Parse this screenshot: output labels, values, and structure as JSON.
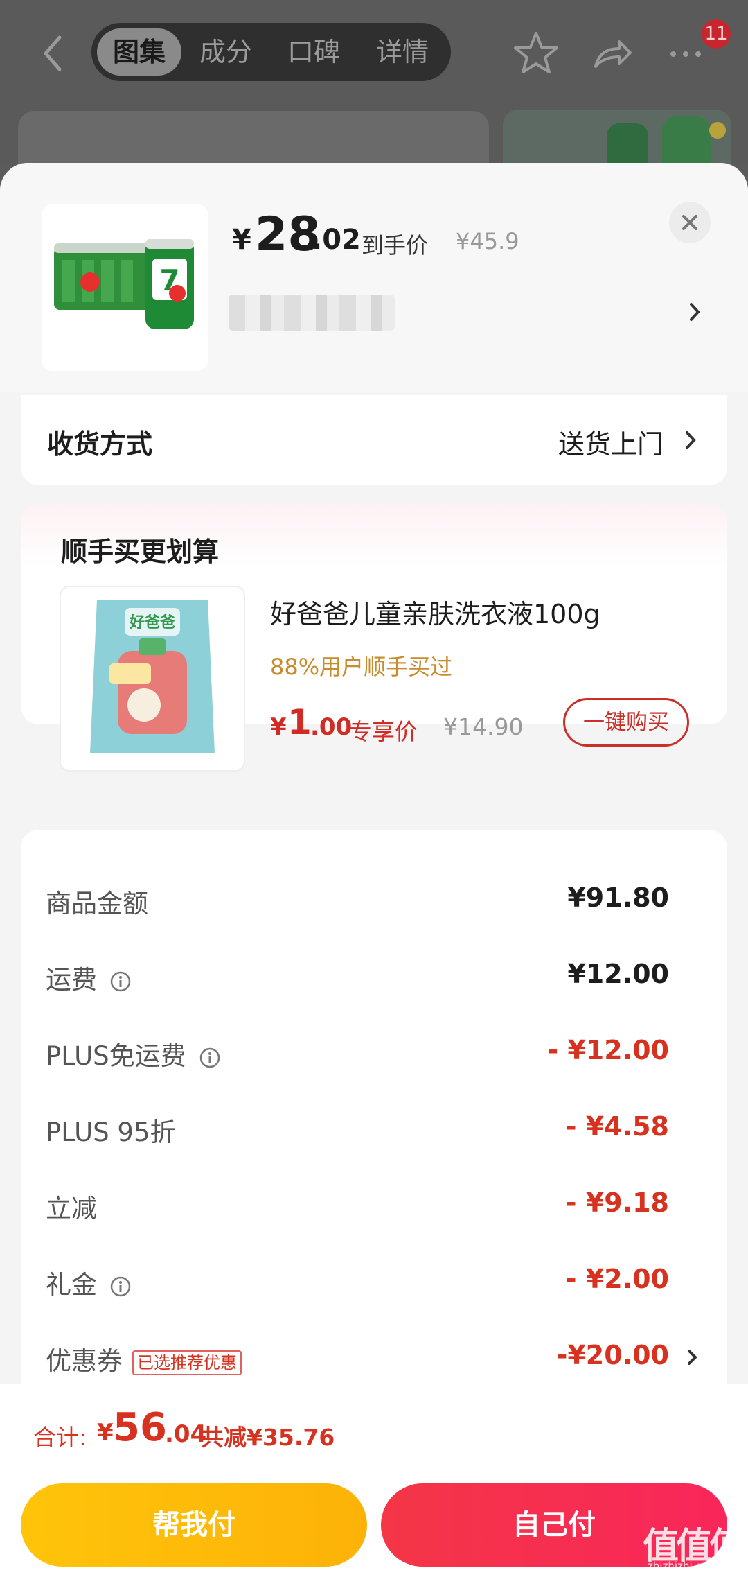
{
  "header": {
    "tabs": [
      "图集",
      "成分",
      "口碑",
      "详情"
    ],
    "active_tab": 0,
    "badge_count": "11"
  },
  "product": {
    "price_currency": "¥",
    "price_int": "28",
    "price_dec": ".02",
    "price_label": "到手价",
    "original_price": "¥45.9"
  },
  "shipping": {
    "label": "收货方式",
    "value": "送货上门"
  },
  "addon": {
    "title": "顺手买更划算",
    "name": "好爸爸儿童亲肤洗衣液100g",
    "percent": "88%用户顺手买过",
    "price_currency": "¥",
    "price_int": "1",
    "price_dec": ".00",
    "price_label": "专享价",
    "original_price": "¥14.90",
    "button": "一键购买"
  },
  "summary": [
    {
      "label": "商品金额",
      "value": "¥91.80"
    },
    {
      "label": "运费",
      "value": "¥12.00"
    },
    {
      "label": "PLUS免运费",
      "value": "- ¥12.00"
    },
    {
      "label": "PLUS 95折",
      "value": "- ¥4.58"
    },
    {
      "label": "立减",
      "value": "- ¥9.18"
    },
    {
      "label": "礼金",
      "value": "- ¥2.00"
    },
    {
      "label": "优惠券",
      "value": "-¥20.00",
      "tag": "已选推荐优惠"
    }
  ],
  "total": {
    "label": "合计:",
    "currency": "¥",
    "int": "56",
    "dec": ".04",
    "savings": "共减¥35.76"
  },
  "buttons": {
    "help_pay": "帮我付",
    "self_pay": "自己付"
  },
  "watermark": {
    "logo": "值值值",
    "site": "zhizhizhi.com"
  },
  "colors": {
    "accent_red": "#d7321f",
    "help_button": "#ffc40a",
    "pay_button": "#f43647"
  }
}
